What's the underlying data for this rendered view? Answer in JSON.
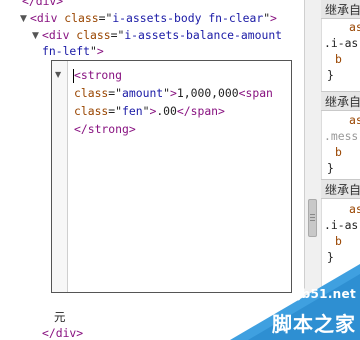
{
  "dom_tree": {
    "top_close": "</div>",
    "assets_body_tag": "div",
    "assets_body_attr": "class",
    "assets_body_class": "i-assets-body fn-clear",
    "balance_tag": "div",
    "balance_attr": "class",
    "balance_class_part1": "i-assets-balance-amount",
    "balance_class_part2": "fn-left",
    "after_text": "元",
    "close_tag": "</div>"
  },
  "edit_box": {
    "strong_open": "<strong",
    "class_attr": "class",
    "amount_class": "amount",
    "amount_text": "1,000,000",
    "span_open": "<span",
    "fen_class": "fen",
    "fen_text": ".00",
    "span_close": "</span>",
    "strong_close": "</strong>"
  },
  "styles": {
    "section_title": "继承自",
    "rules": [
      {
        "frag_top": "as",
        "selector": ".i-as",
        "frag_bottom": "b"
      },
      {
        "frag_top": "as",
        "selector": ".mess",
        "frag_bottom": "b"
      },
      {
        "frag_top": "as",
        "selector": ".i-as",
        "frag_bottom": "b"
      }
    ],
    "extra_frag": "a"
  },
  "watermark": {
    "site": "jb51.net",
    "name": "脚本之家",
    "accent_color": "#3fa0e0"
  }
}
